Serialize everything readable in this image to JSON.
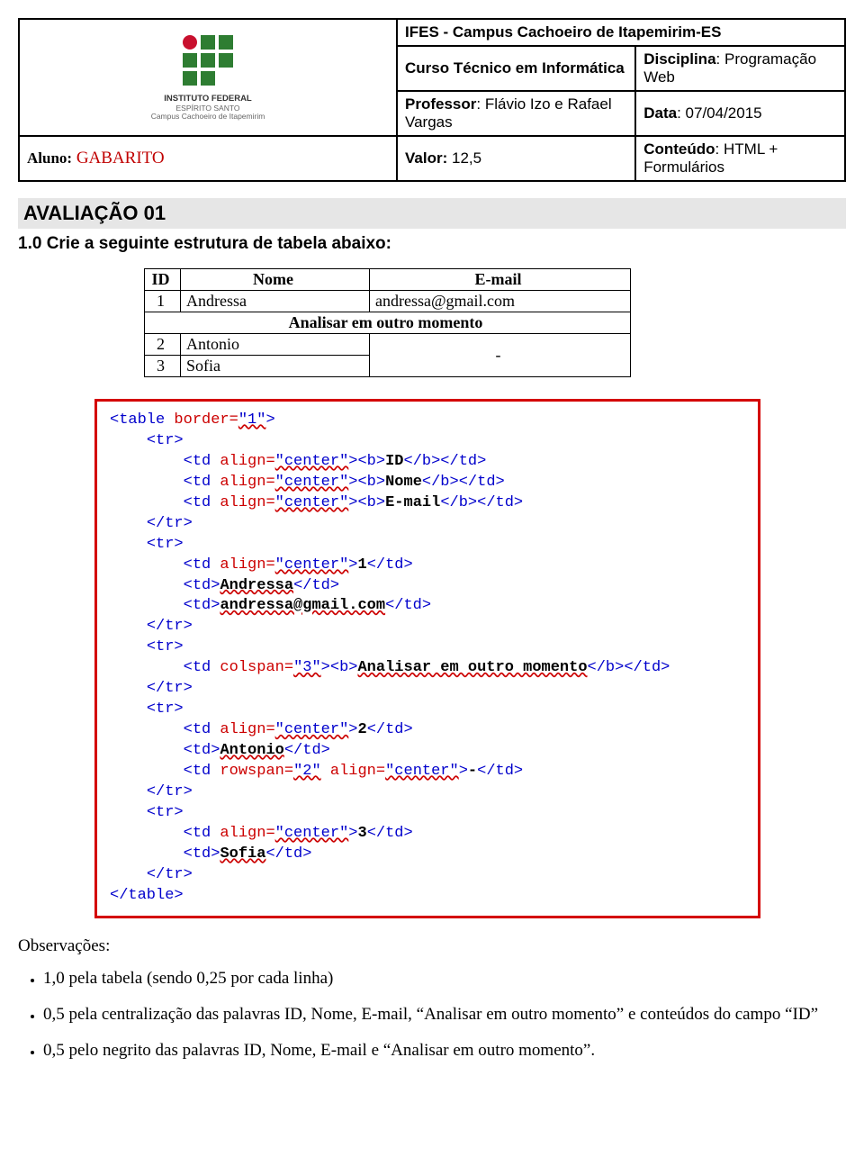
{
  "header": {
    "inst_line": "IFES - Campus Cachoeiro de Itapemirim-ES",
    "curso_label": "Curso Técnico em Informática",
    "disc_label": "Disciplina",
    "disc_value": "Programação Web",
    "prof_label": "Professor",
    "prof_value": "Flávio Izo e Rafael Vargas",
    "data_label": "Data",
    "data_value": "07/04/2015",
    "aluno_label": "Aluno:",
    "aluno_value": "GABARITO",
    "valor_label": "Valor:",
    "valor_value": "12,5",
    "cont_label": "Conteúdo",
    "cont_value": "HTML + Formulários",
    "logo_inst": "INSTITUTO FEDERAL",
    "logo_sub1": "ESPÍRITO SANTO",
    "logo_sub2": "Campus Cachoeiro de Itapemirim"
  },
  "title": "AVALIAÇÃO 01",
  "q1": "1.0 Crie a seguinte estrutura de tabela abaixo:",
  "sample": {
    "h_id": "ID",
    "h_nome": "Nome",
    "h_email": "E-mail",
    "r1_id": "1",
    "r1_nome": "Andressa",
    "r1_email": "andressa@gmail.com",
    "span_row": "Analisar em outro momento",
    "r2_id": "2",
    "r2_nome": "Antonio",
    "r3_id": "3",
    "r3_nome": "Sofia",
    "dash": "-"
  },
  "code": {
    "l01a": "<table",
    "l01b": " border=",
    "l01c": "\"1\"",
    "l01d": ">",
    "l02": "<tr>",
    "l03a": "<td",
    "l03b": " align=",
    "l03c": "\"center\"",
    "l03d": "><b>",
    "l03e": "ID",
    "l03f": "</b></td>",
    "l04e": "Nome",
    "l05e": "E-mail",
    "l06": "</tr>",
    "l08e": "1",
    "l09a": "<td>",
    "l09b": "Andressa",
    "l09c": "</td>",
    "l10b": "andressa@gmail.com",
    "l13a": "<td",
    "l13b": " colspan=",
    "l13c": "\"3\"",
    "l13d": "><b>",
    "l13e": "Analisar em outro momento",
    "l13f": "</b></td>",
    "l16e": "2",
    "l17b": "Antonio",
    "l18a": "<td",
    "l18b": " rowspan=",
    "l18c": "\"2\"",
    "l18d": " align=",
    "l18e": "\"center\"",
    "l18f": ">",
    "l18g": "-",
    "l18h": "</td>",
    "l21e": "3",
    "l22b": "Sofia",
    "l24": "</table>"
  },
  "obs_title": "Observações:",
  "obs": [
    "1,0 pela tabela (sendo 0,25 por cada linha)",
    "0,5 pela centralização das palavras ID, Nome, E-mail, “Analisar em outro momento” e conteúdos do campo “ID”",
    "0,5 pelo negrito das palavras ID, Nome, E-mail e “Analisar em outro momento”."
  ]
}
